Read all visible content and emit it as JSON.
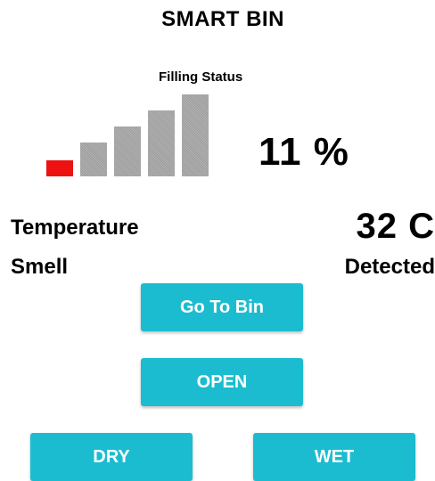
{
  "app": {
    "title": "SMART BIN"
  },
  "filling": {
    "label": "Filling Status",
    "percent_text": "11 %",
    "level_fraction": 0.11,
    "active_color": "#ee1111",
    "inactive_color": "#a6a6a6"
  },
  "readings": {
    "temperature_label": "Temperature",
    "temperature_value": "32 C",
    "smell_label": "Smell",
    "smell_value": "Detected"
  },
  "buttons": {
    "go_to_bin": "Go To Bin",
    "open": "OPEN",
    "dry": "DRY",
    "wet": "WET",
    "color": "#1cbcd0"
  }
}
